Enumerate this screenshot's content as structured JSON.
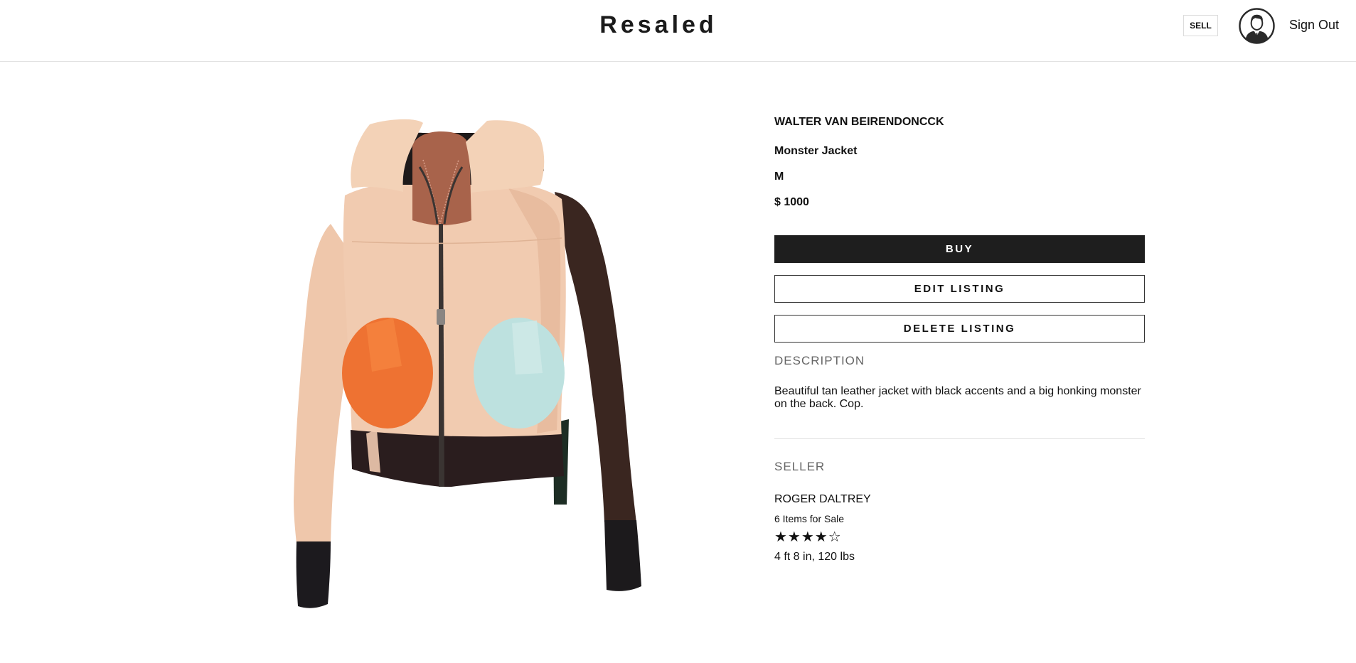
{
  "header": {
    "logo": "Resaled",
    "sell_label": "SELL",
    "avatar_icon": "user-avatar-icon",
    "signout_label": "Sign Out"
  },
  "product": {
    "brand": "WALTER VAN BEIRENDONCCK",
    "name": "Monster Jacket",
    "size": "M",
    "price": "$ 1000",
    "image_icon": "jacket-image"
  },
  "actions": {
    "buy_label": "BUY",
    "edit_label": "EDIT LISTING",
    "delete_label": "DELETE LISTING"
  },
  "description": {
    "title": "DESCRIPTION",
    "text": "Beautiful tan leather jacket with black accents and a big honking monster on the back.  Cop."
  },
  "seller": {
    "title": "SELLER",
    "name": "ROGER DALTREY",
    "items": "6 Items for Sale",
    "rating_display": "★★★★☆",
    "rating": 4,
    "rating_max": 5,
    "stats": "4 ft 8 in, 120 lbs"
  },
  "colors": {
    "accent": "#1e1e1e",
    "muted_heading": "#666666",
    "divider": "#e0e0e0"
  }
}
